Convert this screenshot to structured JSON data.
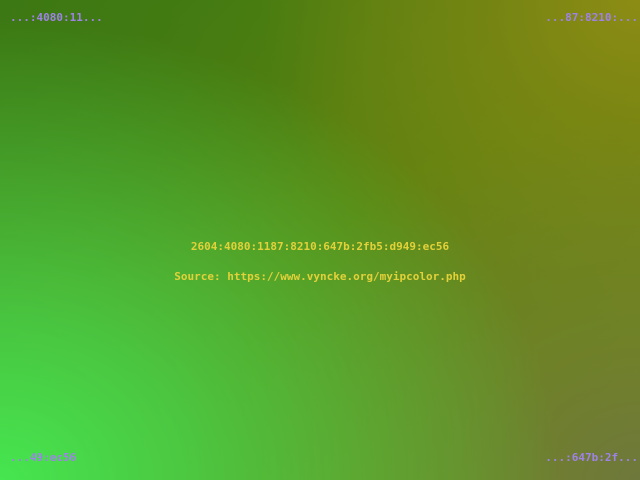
{
  "colors": {
    "corner_text": "#9f82e8",
    "center_text": "#e3d13a"
  },
  "corners": {
    "top_left": "...:4080:11...",
    "top_right": "...87:8210:...",
    "bottom_left": "...49:ec56",
    "bottom_right": "...:647b:2f..."
  },
  "center": {
    "ip": "2604:4080:1187:8210:647b:2fb5:d949:ec56",
    "source": "Source: https://www.vyncke.org/myipcolor.php"
  }
}
